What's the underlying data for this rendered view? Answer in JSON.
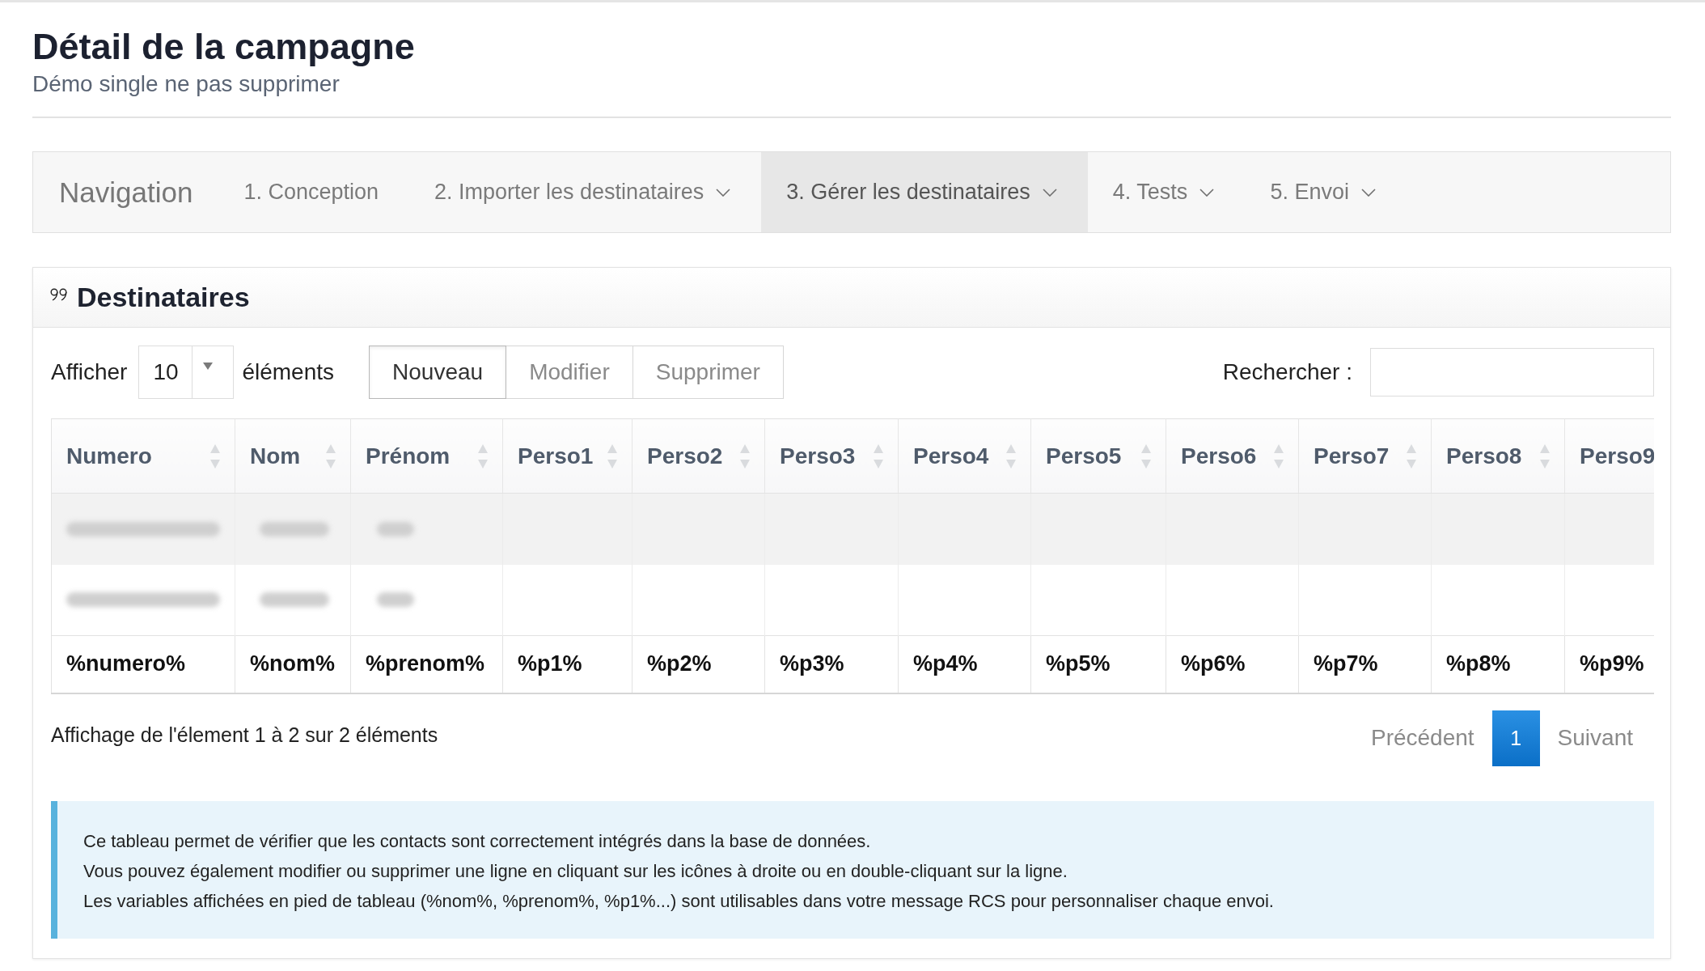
{
  "page": {
    "title": "Détail de la campagne",
    "subtitle": "Démo single ne pas supprimer"
  },
  "navigation": {
    "label": "Navigation",
    "items": [
      {
        "label": "1. Conception",
        "selected": false,
        "dropdown": false
      },
      {
        "label": "2. Importer les destinataires",
        "selected": false,
        "dropdown": true
      },
      {
        "label": "3. Gérer les destinataires",
        "selected": true,
        "dropdown": true
      },
      {
        "label": "4. Tests",
        "selected": false,
        "dropdown": true
      },
      {
        "label": "5. Envoi",
        "selected": false,
        "dropdown": true
      }
    ]
  },
  "panel": {
    "title": "Destinataires",
    "length_menu": {
      "label_before": "Afficher",
      "value": "10",
      "label_after": "éléments"
    },
    "buttons": [
      {
        "label": "Nouveau",
        "disabled": false
      },
      {
        "label": "Modifier",
        "disabled": true
      },
      {
        "label": "Supprimer",
        "disabled": true
      }
    ],
    "search": {
      "label": "Rechercher :"
    },
    "table": {
      "columns": [
        {
          "label": "Numero",
          "sort_icon": true
        },
        {
          "label": "Nom",
          "sort_icon": true
        },
        {
          "label": "Prénom",
          "sort_icon": true
        },
        {
          "label": "Perso1",
          "sort_icon": true
        },
        {
          "label": "Perso2",
          "sort_icon": true
        },
        {
          "label": "Perso3",
          "sort_icon": true
        },
        {
          "label": "Perso4",
          "sort_icon": true
        },
        {
          "label": "Perso5",
          "sort_icon": true
        },
        {
          "label": "Perso6",
          "sort_icon": true
        },
        {
          "label": "Perso7",
          "sort_icon": true
        },
        {
          "label": "Perso8",
          "sort_icon": true
        },
        {
          "label": "Perso9",
          "sort_icon": false
        }
      ],
      "rows": [
        {
          "cells": [
            {
              "kind": "blurred"
            },
            {
              "kind": "blurred"
            },
            {
              "kind": "blurred"
            }
          ]
        },
        {
          "cells": [
            {
              "kind": "blurred"
            },
            {
              "kind": "blurred"
            },
            {
              "kind": "blurred"
            }
          ]
        }
      ],
      "footer": [
        "%numero%",
        "%nom%",
        "%prenom%",
        "%p1%",
        "%p2%",
        "%p3%",
        "%p4%",
        "%p5%",
        "%p6%",
        "%p7%",
        "%p8%",
        "%p9%"
      ]
    },
    "info": "Affichage de l'élement 1 à 2 sur 2 éléments",
    "pagination": {
      "previous": {
        "label": "Précédent",
        "disabled": true
      },
      "pages": [
        {
          "label": "1",
          "selected": true
        }
      ],
      "next": {
        "label": "Suivant",
        "disabled": true
      }
    },
    "note": {
      "lines": [
        "Ce tableau permet de vérifier que les contacts sont correctement intégrés dans la base de données.",
        "Vous pouvez également modifier ou supprimer une ligne en cliquant sur les icônes à droite ou en double-cliquant sur la ligne.",
        "Les variables affichées en pied de tableau (%nom%, %prenom%, %p1%...) sont utilisables dans votre message RCS pour personnaliser chaque envoi."
      ]
    }
  }
}
